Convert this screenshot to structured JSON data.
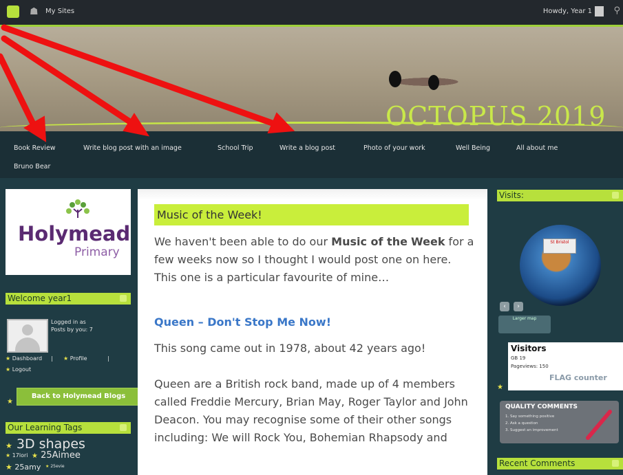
{
  "adminbar": {
    "my_sites": "My Sites",
    "howdy": "Howdy, Year 1"
  },
  "header": {
    "site_title": "OCTOPUS 2019"
  },
  "nav": {
    "items": [
      "Book Review",
      "Write blog post with an image",
      "School Trip",
      "Write a blog post",
      "Photo of your work",
      "Well Being",
      "All about me",
      "Bruno Bear"
    ]
  },
  "left": {
    "logo_name": "Holymead",
    "logo_sub": "Primary",
    "welcome_title": "Welcome year1",
    "logged_in": "Logged in as",
    "posts_by_you": "Posts by you: 7",
    "dashboard": "Dashboard",
    "separator": "|",
    "profile": "Profile",
    "logout": "Logout",
    "back_button": "Back to Holymead Blogs",
    "tags_title": "Our Learning Tags",
    "tag_big": "3D shapes",
    "tag_row1a": "17lori",
    "tag_row1b": "25Aimee",
    "tag_row2a": "25amy",
    "tag_row2b": "25evie"
  },
  "main": {
    "post_title": "Music of the Week!",
    "para1_a": "We haven't been able to do our ",
    "para1_bold1": "Music of the",
    "para1_bold2": "Week",
    "para1_b": " for a few weeks now so I thought I would post one on here. This one is a particular favourite of mine…",
    "song_link": "Queen – Don't Stop Me Now!",
    "para2": "This song came out in 1978, about 42 years ago!",
    "para3": "Queen are a British rock band, made up of 4 members called Freddie Mercury, Brian May, Roger Taylor and John Deacon. You may recognise some of their other songs including: We will Rock You, Bohemian Rhapsody and"
  },
  "right": {
    "visits_title": "Visits:",
    "globe_sign": "St Bristol",
    "map_button": "Larger map",
    "visitors_title": "Visitors",
    "visitors_uk": "GB  19",
    "pageviews": "Pageviews:  150",
    "flag_counter": "FLAG counter",
    "qc_title": "QUALITY COMMENTS",
    "qc_1": "1. Say something positive",
    "qc_2": "2. Ask a question",
    "qc_3": "3. Suggest an improvement",
    "recent_title": "Recent Comments"
  },
  "colors": {
    "accent_green": "#b7e03c",
    "link_blue": "#3a77c8",
    "annotation_red": "#ee1111"
  }
}
